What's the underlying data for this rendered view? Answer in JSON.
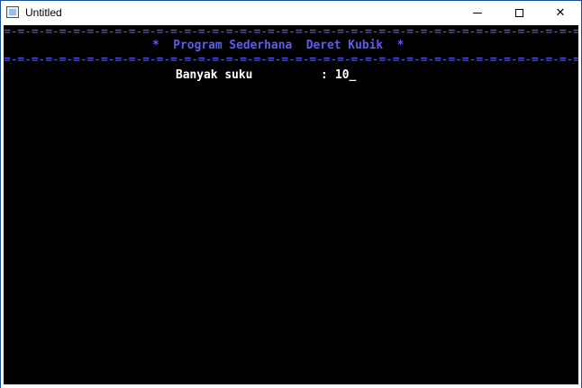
{
  "window": {
    "title": "Untitled",
    "icons": {
      "app": "console-window-icon",
      "minimize": "minimize-icon",
      "maximize": "maximize-icon",
      "close": "close-icon"
    },
    "close_glyph": "✕"
  },
  "console": {
    "separator_top": "=-=-=-=-=-=-=-=-=-=-=-=-=-=-=-=-=-=-=-=-=-=-=-=-=-=-=-=-=-=-=-=-=-=-=-=-=-=-=-=-=-=",
    "heading": "*  Program Sederhana  Deret Kubik  *",
    "separator_bottom": "=-=-=-=-=-=-=-=-=-=-=-=-=-=-=-=-=-=-=-=-=-=-=-=-=-=-=-=-=-=-=-=-=-=-=-=-=-=-=-=-=-=",
    "prompt_label": "Banyak suku",
    "prompt_separator": ":",
    "input_value": "10",
    "cursor": "_"
  },
  "colors": {
    "console_background": "#000000",
    "heading_text": "#5c5cf0",
    "prompt_text": "#ffffff"
  }
}
